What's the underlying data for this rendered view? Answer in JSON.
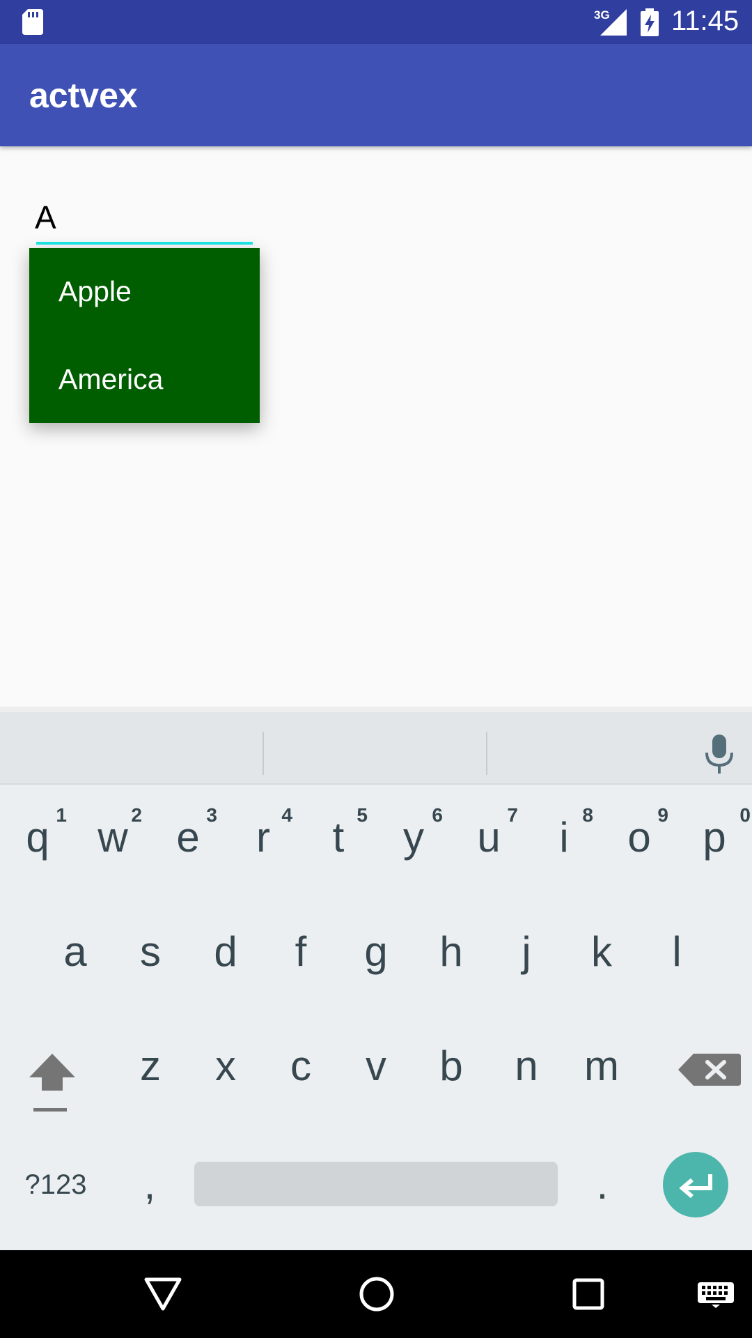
{
  "status_bar": {
    "network": "3G",
    "time": "11:45"
  },
  "app_bar": {
    "title": "actvex"
  },
  "edit_text": {
    "value": "A"
  },
  "dropdown": {
    "items": [
      "Apple",
      "America"
    ]
  },
  "keyboard": {
    "row1": [
      {
        "char": "q",
        "hint": "1"
      },
      {
        "char": "w",
        "hint": "2"
      },
      {
        "char": "e",
        "hint": "3"
      },
      {
        "char": "r",
        "hint": "4"
      },
      {
        "char": "t",
        "hint": "5"
      },
      {
        "char": "y",
        "hint": "6"
      },
      {
        "char": "u",
        "hint": "7"
      },
      {
        "char": "i",
        "hint": "8"
      },
      {
        "char": "o",
        "hint": "9"
      },
      {
        "char": "p",
        "hint": "0"
      }
    ],
    "row2": [
      "a",
      "s",
      "d",
      "f",
      "g",
      "h",
      "j",
      "k",
      "l"
    ],
    "row3": [
      "z",
      "x",
      "c",
      "v",
      "b",
      "n",
      "m"
    ],
    "symbols_label": "?123",
    "comma_label": ",",
    "period_label": ".",
    "icons": {
      "shift": "shift-icon",
      "backspace": "backspace-icon",
      "enter": "enter-icon",
      "mic": "mic-icon"
    }
  },
  "colors": {
    "status_bar": "#303f9f",
    "app_bar": "#3f51b5",
    "dropdown_bg": "#005e00",
    "underline": "#1de9e9",
    "enter_key": "#4db6ac"
  },
  "nav_bar": {
    "icons": [
      "back-icon",
      "home-icon",
      "recents-icon",
      "keyboard-switch-icon"
    ]
  }
}
